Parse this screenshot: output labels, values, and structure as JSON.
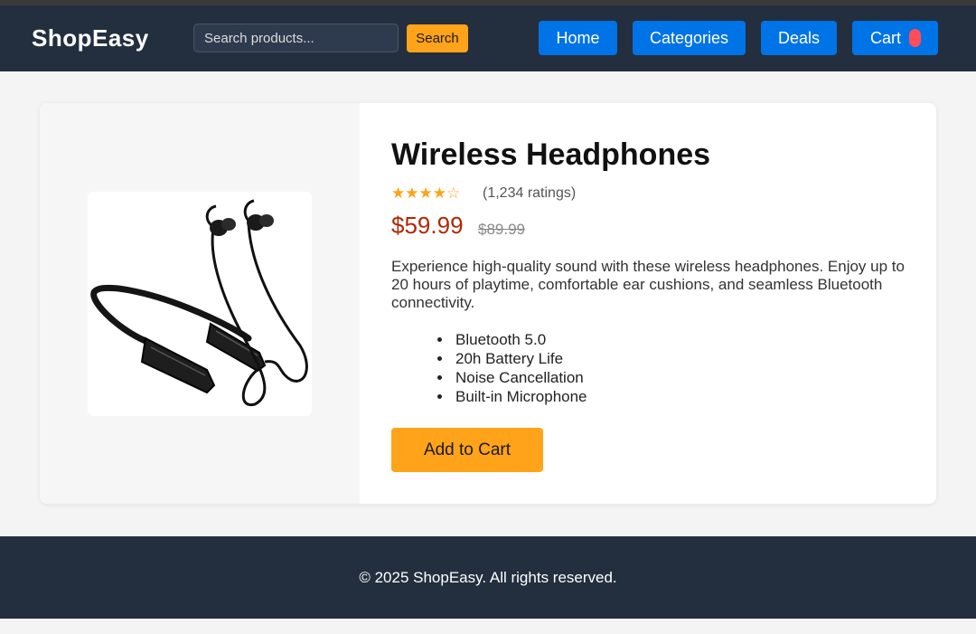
{
  "header": {
    "logo": "ShopEasy",
    "search": {
      "placeholder": "Search products...",
      "value": "",
      "button_label": "Search"
    },
    "nav": {
      "home": "Home",
      "categories": "Categories",
      "deals": "Deals",
      "cart": "Cart"
    }
  },
  "product": {
    "image_alt": "wireless neckband earphones",
    "title": "Wireless Headphones",
    "stars": "★★★★☆",
    "rating_value": 4,
    "rating_max": 5,
    "ratings_text": "(1,234 ratings)",
    "price": "$59.99",
    "old_price": "$89.99",
    "description": "Experience high-quality sound with these wireless headphones. Enjoy up to 20 hours of playtime, comfortable ear cushions, and seamless Bluetooth connectivity.",
    "features": [
      "Bluetooth 5.0",
      "20h Battery Life",
      "Noise Cancellation",
      "Built-in Microphone"
    ],
    "add_to_cart_label": "Add to Cart"
  },
  "footer": {
    "text": "© 2025 ShopEasy. All rights reserved."
  },
  "colors": {
    "header_bg": "#232f3e",
    "accent_orange": "#ffa31a",
    "nav_blue": "#0073e6",
    "price_red": "#b12704",
    "cart_badge": "#ff4d5a"
  }
}
